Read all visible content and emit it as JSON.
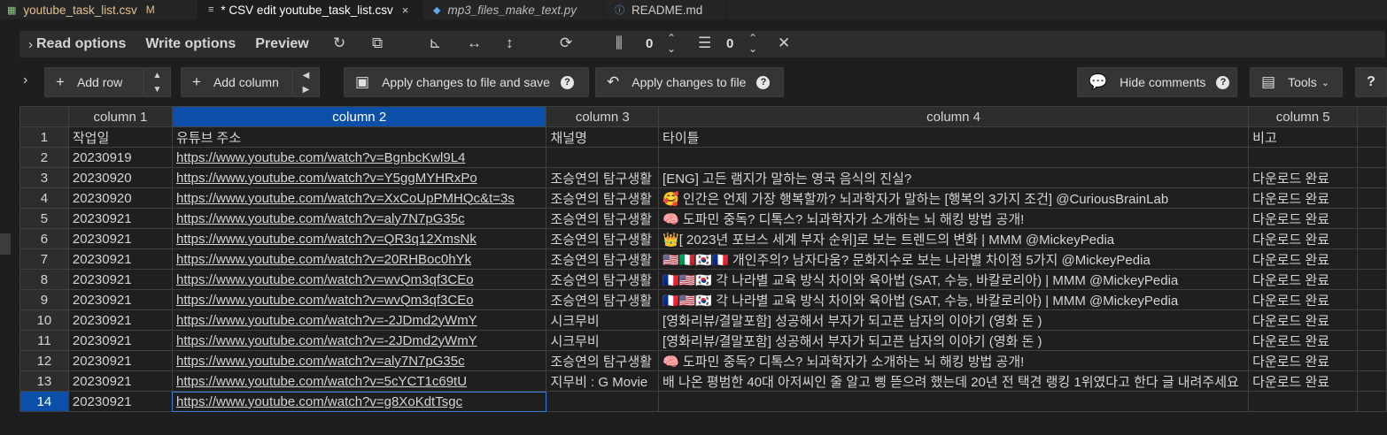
{
  "tabs": [
    {
      "label": "youtube_task_list.csv",
      "modified": "M"
    },
    {
      "label": "* CSV edit youtube_task_list.csv",
      "close": "×"
    },
    {
      "label": "mp3_files_make_text.py"
    },
    {
      "label": "README.md"
    }
  ],
  "options_bar": {
    "read_options": "Read options",
    "write_options": "Write options",
    "preview": "Preview",
    "fixed_columns": "0",
    "fixed_rows": "0"
  },
  "toolbar": {
    "add_row": "Add row",
    "add_column": "Add column",
    "apply_save": "Apply changes to file and save",
    "apply": "Apply changes to file",
    "hide_comments": "Hide comments",
    "tools": "Tools",
    "help": "?"
  },
  "table": {
    "headers": [
      "column 1",
      "column 2",
      "column 3",
      "column 4",
      "column 5"
    ],
    "selected_column": 2,
    "selected_row": 14,
    "rows": [
      [
        "1",
        "작업일",
        "유튜브 주소",
        "채널명",
        "타이틀",
        "비고"
      ],
      [
        "2",
        "20230919",
        "https://www.youtube.com/watch?v=BgnbcKwl9L4",
        "",
        "",
        ""
      ],
      [
        "3",
        "20230920",
        "https://www.youtube.com/watch?v=Y5ggMYHRxPo",
        "조승연의 탐구생활",
        "[ENG] 고든 램지가 말하는 영국 음식의 진실?",
        "다운로드 완료"
      ],
      [
        "4",
        "20230920",
        "https://www.youtube.com/watch?v=XxCoUpPMHQc&t=3s",
        "조승연의 탐구생활",
        "🥰 인간은 언제 가장 행복할까? 뇌과학자가 말하는 [행복의 3가지 조건] @CuriousBrainLab",
        "다운로드 완료"
      ],
      [
        "5",
        "20230921",
        "https://www.youtube.com/watch?v=aly7N7pG35c",
        "조승연의 탐구생활",
        "🧠 도파민 중독? 디톡스? 뇌과학자가 소개하는 뇌 해킹 방법 공개!",
        "다운로드 완료"
      ],
      [
        "6",
        "20230921",
        "https://www.youtube.com/watch?v=QR3q12XmsNk",
        "조승연의 탐구생활",
        "👑[ 2023년 포브스 세계 부자 순위]로 보는 트렌드의 변화 | MMM @MickeyPedia",
        "다운로드 완료"
      ],
      [
        "7",
        "20230921",
        "https://www.youtube.com/watch?v=20RHBoc0hYk",
        "조승연의 탐구생활",
        "🇺🇸🇮🇹🇰🇷🇫🇷 개인주의? 남자다움? 문화지수로 보는 나라별 차이점 5가지 @MickeyPedia",
        "다운로드 완료"
      ],
      [
        "8",
        "20230921",
        "https://www.youtube.com/watch?v=wvQm3qf3CEo",
        "조승연의 탐구생활",
        "🇫🇷🇺🇸🇰🇷 각 나라별 교육 방식 차이와 육아법 (SAT, 수능, 바칼로리아) | MMM @MickeyPedia",
        "다운로드 완료"
      ],
      [
        "9",
        "20230921",
        "https://www.youtube.com/watch?v=wvQm3qf3CEo",
        "조승연의 탐구생활",
        "🇫🇷🇺🇸🇰🇷 각 나라별 교육 방식 차이와 육아법 (SAT, 수능, 바칼로리아) | MMM @MickeyPedia",
        "다운로드 완료"
      ],
      [
        "10",
        "20230921",
        "https://www.youtube.com/watch?v=-2JDmd2yWmY",
        "시크무비",
        "[영화리뷰/결말포함] 성공해서 부자가 되고픈 남자의 이야기 (영화 돈 )",
        "다운로드 완료"
      ],
      [
        "11",
        "20230921",
        "https://www.youtube.com/watch?v=-2JDmd2yWmY",
        "시크무비",
        "[영화리뷰/결말포함] 성공해서 부자가 되고픈 남자의 이야기 (영화 돈 )",
        "다운로드 완료"
      ],
      [
        "12",
        "20230921",
        "https://www.youtube.com/watch?v=aly7N7pG35c",
        "조승연의 탐구생활",
        "🧠 도파민 중독? 디톡스? 뇌과학자가 소개하는 뇌 해킹 방법 공개!",
        "다운로드 완료"
      ],
      [
        "13",
        "20230921",
        "https://www.youtube.com/watch?v=5cYCT1c69tU",
        "지무비 : G Movie",
        "배 나온 평범한 40대 아저씨인 줄 알고 삥 뜯으려 했는데 20년 전 택견 랭킹 1위였다고 한다 글 내려주세요",
        "다운로드 완료"
      ],
      [
        "14",
        "20230921",
        "https://www.youtube.com/watch?v=g8XoKdtTsgc",
        "",
        "",
        ""
      ]
    ]
  },
  "colors": {
    "selection": "#0b4fa8",
    "background": "#1e1e1e",
    "header": "#2d2d2d"
  }
}
